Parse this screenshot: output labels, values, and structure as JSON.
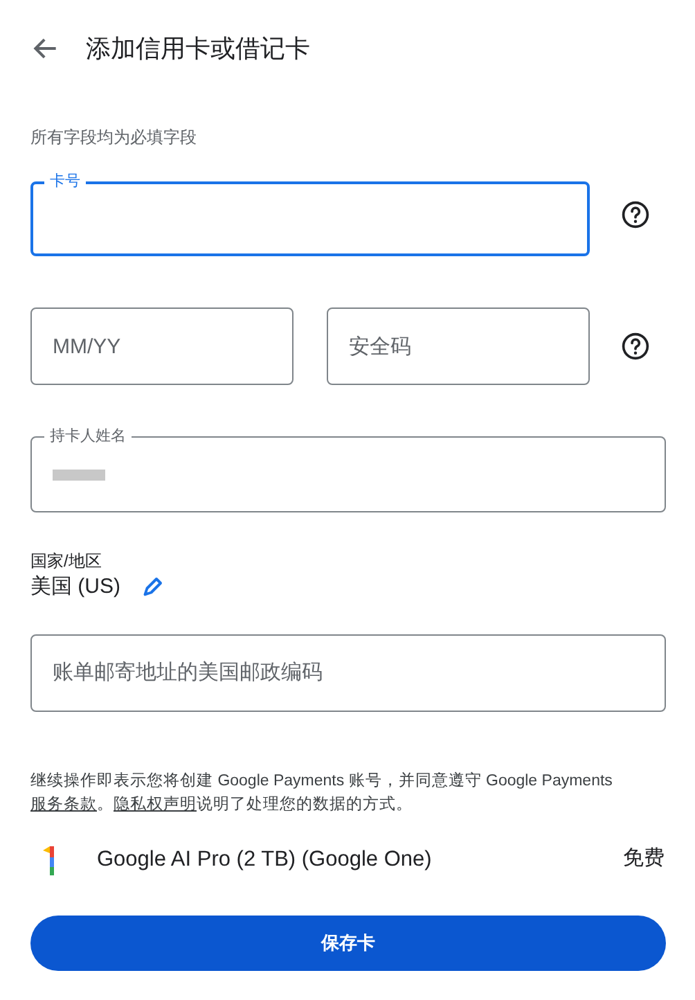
{
  "header": {
    "title": "添加信用卡或借记卡"
  },
  "required_note": "所有字段均为必填字段",
  "card_number": {
    "label": "卡号",
    "focused": true
  },
  "expiry": {
    "placeholder": "MM/YY"
  },
  "security_code": {
    "placeholder": "安全码"
  },
  "cardholder": {
    "label": "持卡人姓名",
    "redacted": true
  },
  "country": {
    "label": "国家/地区",
    "value": "美国 (US)"
  },
  "zip": {
    "placeholder": "账单邮寄地址的美国邮政编码"
  },
  "legal": [
    {
      "kind": "text",
      "text": "继续操作即表示您将创建 Google Payments 账号，并同意遵守 Google Payments "
    },
    {
      "kind": "link",
      "text": "服务条款"
    },
    {
      "kind": "text",
      "text": "。"
    },
    {
      "kind": "link",
      "text": "隐私权声明"
    },
    {
      "kind": "text",
      "text": "说明了处理您的数据的方式。"
    }
  ],
  "product": {
    "name": "Google AI Pro (2 TB) (Google One)",
    "price": "免费"
  },
  "save_button": "保存卡"
}
